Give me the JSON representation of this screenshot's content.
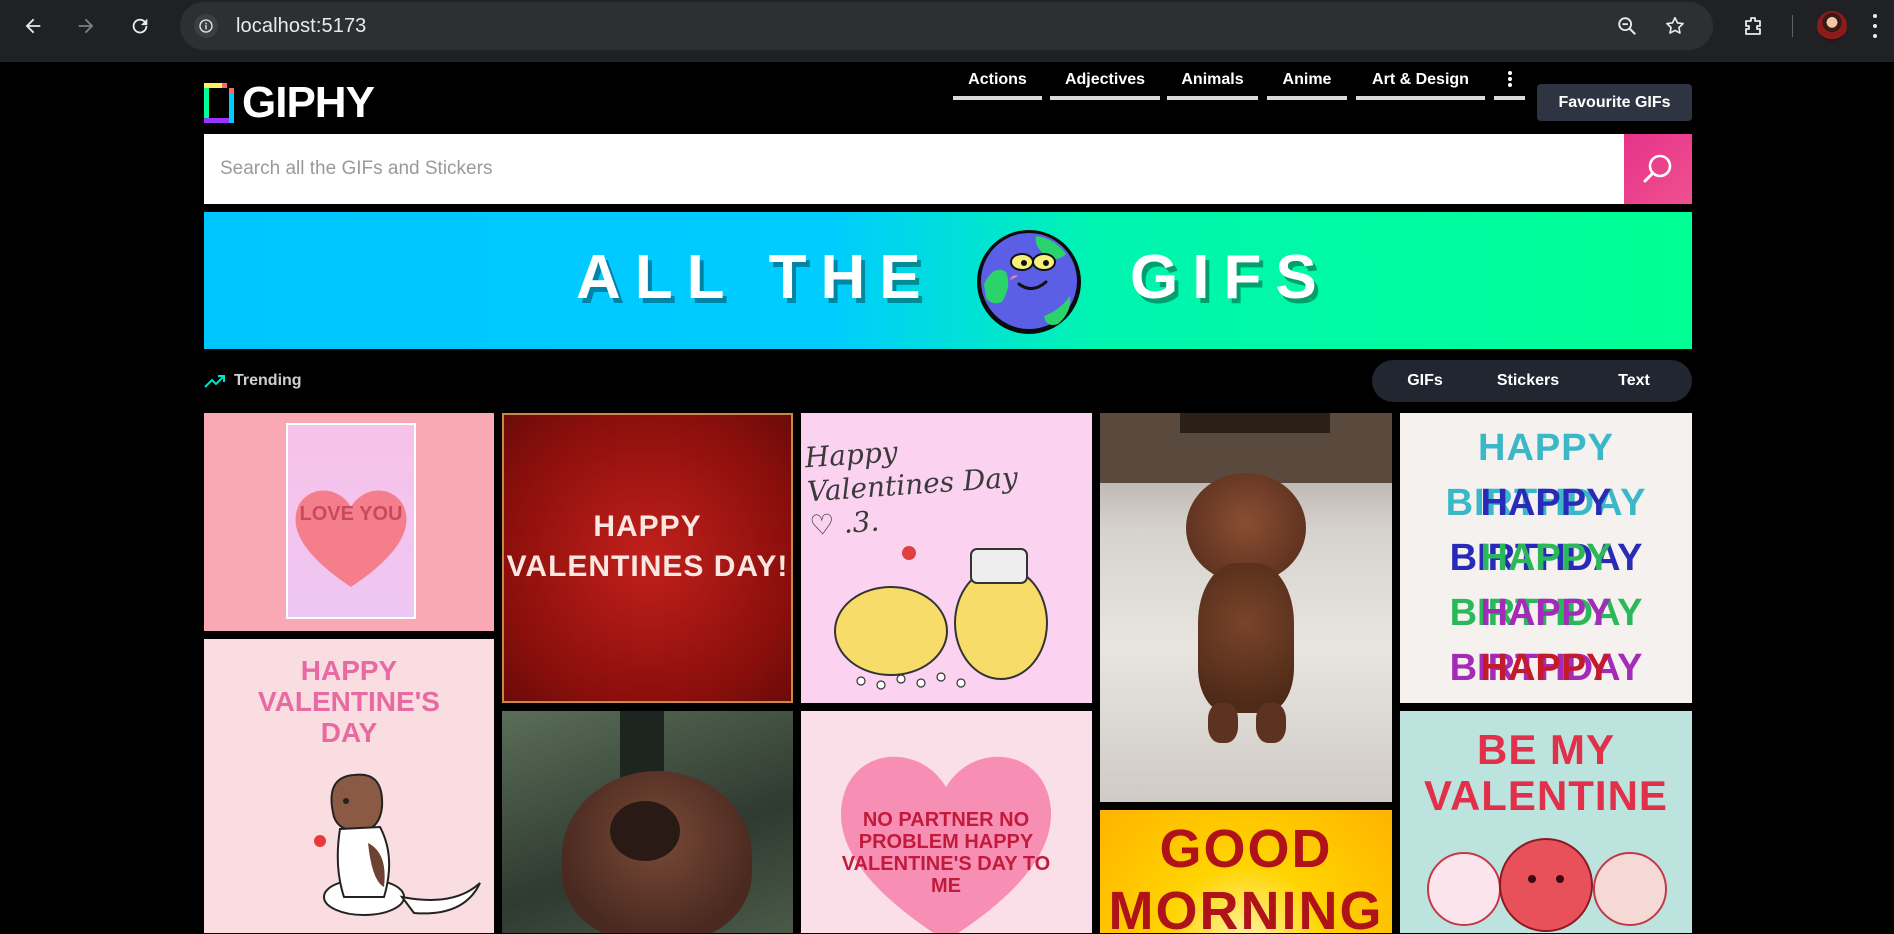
{
  "browser": {
    "url": "localhost:5173"
  },
  "site": {
    "logo_text": "GIPHY",
    "categories": [
      "Actions",
      "Adjectives",
      "Animals",
      "Anime",
      "Art & Design"
    ],
    "favourites_label": "Favourite GIFs",
    "search_placeholder": "Search all the GIFs and Stickers",
    "banner": {
      "left_text": "ALL THE",
      "right_text": "GIFS"
    },
    "trending_label": "Trending",
    "tabs": [
      "GIFs",
      "Stickers",
      "Text"
    ],
    "gifs": [
      {
        "text": "LOVE YOU"
      },
      {
        "text": "HAPPY VALENTINES DAY!"
      },
      {
        "text": "Happy Valentines Day ♡ .3."
      },
      {
        "text": ""
      },
      {
        "text": "HAPPY BIRTHDAY"
      },
      {
        "text": "HAPPY VALENTINE'S DAY"
      },
      {
        "text": ""
      },
      {
        "text": "NO PARTNER NO PROBLEM HAPPY VALENTINE'S DAY TO ME"
      },
      {
        "text": "GOOD MORNING"
      },
      {
        "text": "BE MY VALENTINE"
      }
    ]
  },
  "colors": {
    "search_button": "#e6338a",
    "banner_left": "#00c6ff",
    "banner_right": "#00ff94",
    "tabs_bg": "#212631",
    "favourites_bg": "#2e3441"
  }
}
